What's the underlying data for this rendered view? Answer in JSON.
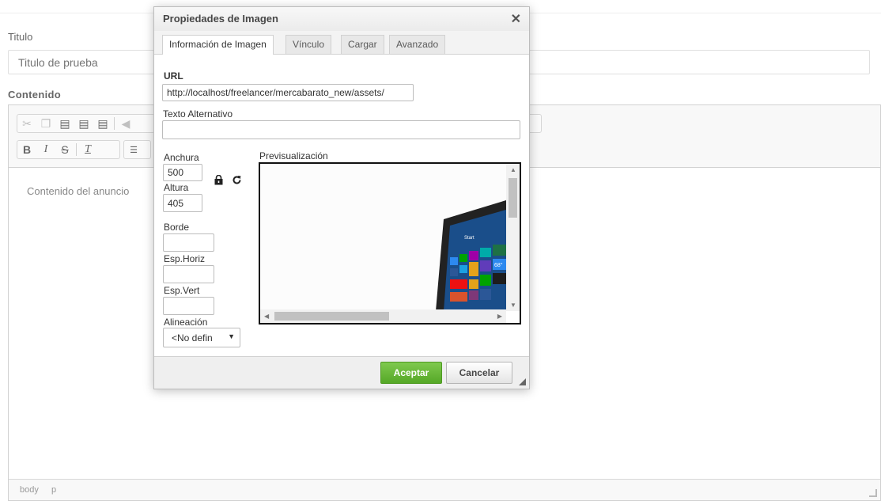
{
  "page": {
    "titulo_label": "Titulo",
    "titulo_placeholder": "Titulo de prueba",
    "contenido_label": "Contenido",
    "editor_placeholder": "Contenido del anuncio",
    "status_path": [
      "body",
      "p"
    ]
  },
  "toolbar": {
    "row1_icons": [
      "cut-icon",
      "copy-icon",
      "paste-icon",
      "paste-text-icon",
      "paste-word-icon",
      "undo-icon"
    ],
    "row2_icons": [
      "bold-icon",
      "italic-icon",
      "strike-icon",
      "remove-format-icon",
      "numbered-list-icon"
    ]
  },
  "dialog": {
    "title": "Propiedades de Imagen",
    "tabs": [
      {
        "label": "Información de Imagen",
        "active": true
      },
      {
        "label": "Vínculo",
        "active": false
      },
      {
        "label": "Cargar",
        "active": false
      },
      {
        "label": "Avanzado",
        "active": false
      }
    ],
    "url_label": "URL",
    "url_value": "http://localhost/freelancer/mercabarato_new/assets/",
    "alt_label": "Texto Alternativo",
    "alt_value": "",
    "width_label": "Anchura",
    "width_value": "500",
    "height_label": "Altura",
    "height_value": "405",
    "border_label": "Borde",
    "hspace_label": "Esp.Horiz",
    "vspace_label": "Esp.Vert",
    "align_label": "Alineación",
    "align_value": "<No defin",
    "preview_label": "Previsualización",
    "ok_label": "Aceptar",
    "cancel_label": "Cancelar"
  },
  "colors": {
    "ok_button": "#55a827",
    "tablet_screen": "#1a4e8a"
  }
}
